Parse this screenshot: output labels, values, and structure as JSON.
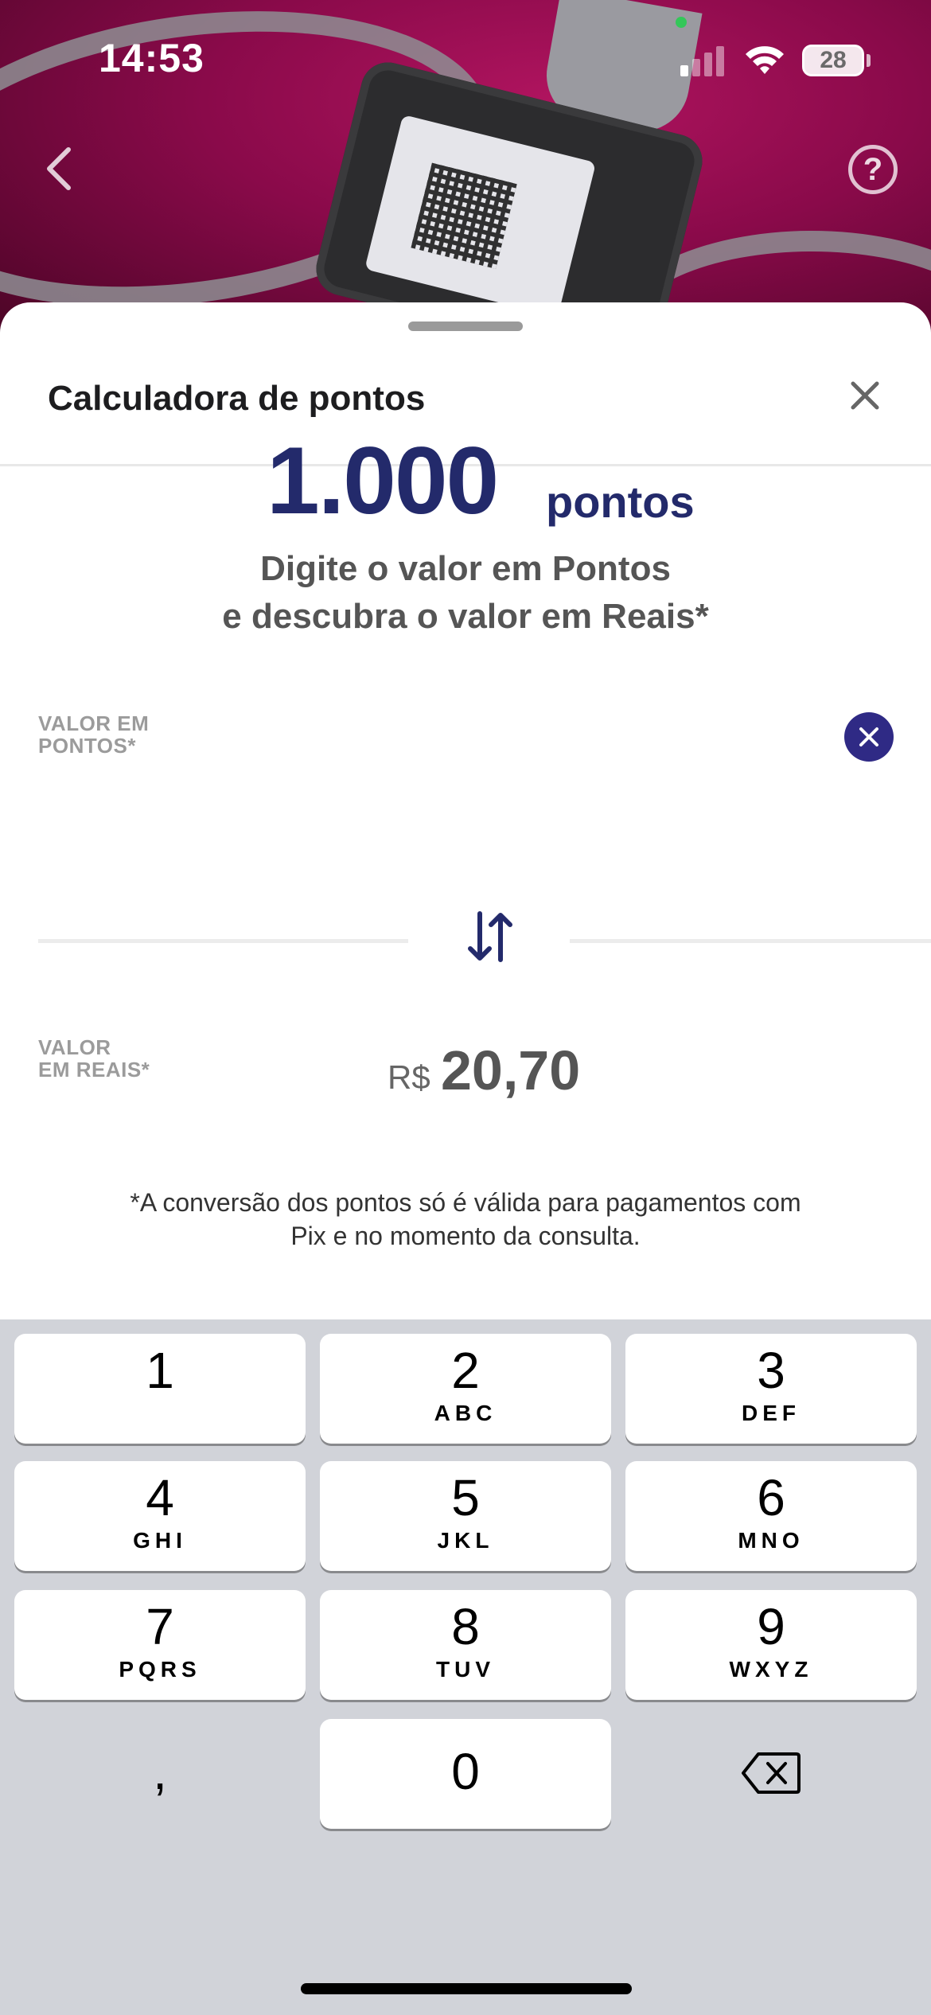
{
  "status_bar": {
    "time": "14:53",
    "battery": "28"
  },
  "header": {
    "back_icon": "chevron-left-icon",
    "help_icon": "question-circle-icon",
    "help_glyph": "?"
  },
  "sheet": {
    "title": "Calculadora de pontos",
    "close_icon": "close-icon",
    "headline_line1": "Digite o valor em Pontos",
    "headline_line2": "e descubra o valor em Reais*",
    "points": {
      "label_line1": "VALOR EM",
      "label_line2": "PONTOS*",
      "value": "1.000",
      "unit": "pontos"
    },
    "reais": {
      "label_line1": "VALOR",
      "label_line2": "EM REAIS*",
      "currency": "R$",
      "value": "20,70"
    },
    "disclaimer_line1": "*A conversão dos pontos só é válida para pagamentos com",
    "disclaimer_line2": "Pix e no momento da consulta."
  },
  "keypad": {
    "keys": [
      {
        "num": "1",
        "letters": ""
      },
      {
        "num": "2",
        "letters": "ABC"
      },
      {
        "num": "3",
        "letters": "DEF"
      },
      {
        "num": "4",
        "letters": "GHI"
      },
      {
        "num": "5",
        "letters": "JKL"
      },
      {
        "num": "6",
        "letters": "MNO"
      },
      {
        "num": "7",
        "letters": "PQRS"
      },
      {
        "num": "8",
        "letters": "TUV"
      },
      {
        "num": "9",
        "letters": "WXYZ"
      },
      {
        "num": ",",
        "letters": ""
      },
      {
        "num": "0",
        "letters": ""
      }
    ],
    "delete_icon": "backspace-icon"
  },
  "colors": {
    "brand_navy": "#232a6b",
    "clear_button": "#2f2a85",
    "hero_magenta": "#8a0a4a",
    "keypad_bg": "#d1d3d9"
  }
}
